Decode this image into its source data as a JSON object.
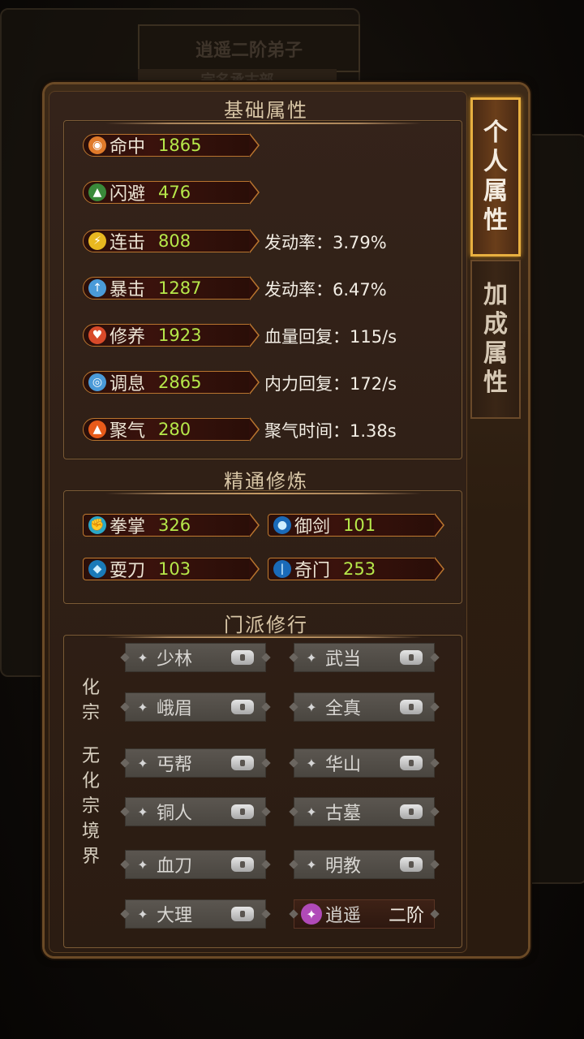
{
  "background": {
    "title": "逍遥二阶弟子",
    "subtitle": "宗名承古部"
  },
  "tabs": [
    {
      "label": "个人属性",
      "active": true
    },
    {
      "label": "加成属性",
      "active": false
    }
  ],
  "sections": {
    "basic": "基础属性",
    "mastery": "精通修炼",
    "sect": "门派修行"
  },
  "basic_stats": [
    {
      "name": "命中",
      "value": "1865",
      "extra": "",
      "icon": "target-icon",
      "color": "#e07a2a"
    },
    {
      "name": "闪避",
      "value": "476",
      "extra": "",
      "icon": "boot-icon",
      "color": "#3a8a3a"
    },
    {
      "name": "连击",
      "value": "808",
      "extra": "发动率：3.79%",
      "icon": "lightning-icon",
      "color": "#e8b820"
    },
    {
      "name": "暴击",
      "value": "1287",
      "extra": "发动率：6.47%",
      "icon": "sword-icon",
      "color": "#4a9ad8"
    },
    {
      "name": "修养",
      "value": "1923",
      "extra": "血量回复：115/s",
      "icon": "heart-icon",
      "color": "#d84a2a"
    },
    {
      "name": "调息",
      "value": "2865",
      "extra": "内力回复：172/s",
      "icon": "breath-icon",
      "color": "#4a9ad8"
    },
    {
      "name": "聚气",
      "value": "280",
      "extra": "聚气时间：1.38s",
      "icon": "flame-icon",
      "color": "#e85a1a"
    }
  ],
  "mastery": [
    {
      "name": "拳掌",
      "value": "326",
      "icon": "fist-icon"
    },
    {
      "name": "御剑",
      "value": "101",
      "icon": "drop-icon"
    },
    {
      "name": "耍刀",
      "value": "103",
      "icon": "blade-icon"
    },
    {
      "name": "奇门",
      "value": "253",
      "icon": "rune-icon"
    }
  ],
  "realm_labels": {
    "hua_zong": "化宗",
    "wu_hua_zong": "无化宗境界"
  },
  "sects_left": [
    {
      "name": "少林",
      "icon": "shaolin-icon"
    },
    {
      "name": "峨眉",
      "icon": "emei-icon"
    },
    {
      "name": "丐帮",
      "icon": "gaibang-icon"
    },
    {
      "name": "铜人",
      "icon": "tongren-icon"
    },
    {
      "name": "血刀",
      "icon": "xuedao-icon"
    },
    {
      "name": "大理",
      "icon": "dali-icon"
    }
  ],
  "sects_right": [
    {
      "name": "武当",
      "icon": "wudang-icon"
    },
    {
      "name": "全真",
      "icon": "quanzhen-icon"
    },
    {
      "name": "华山",
      "icon": "huashan-icon"
    },
    {
      "name": "古墓",
      "icon": "gumu-icon"
    },
    {
      "name": "明教",
      "icon": "mingjiao-icon"
    },
    {
      "name": "逍遥",
      "icon": "xiaoyao-icon",
      "rank": "二阶"
    }
  ],
  "colors": {
    "stat_value": "#b6e84a",
    "tab_active_border": "#e8b040",
    "pill_border": "#b8742e"
  }
}
